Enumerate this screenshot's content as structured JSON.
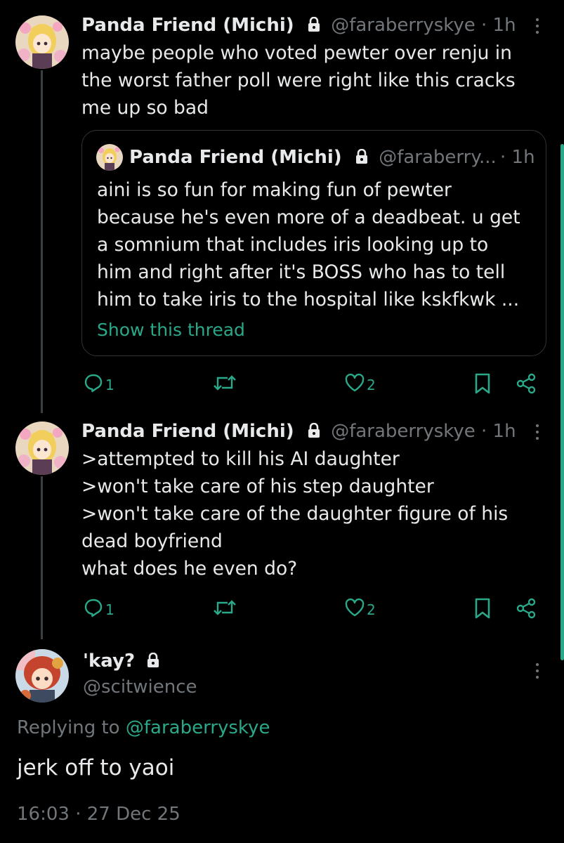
{
  "colors": {
    "background": "#000000",
    "accent": "#2aa889",
    "text": "#e7e9ea",
    "muted": "#71767b",
    "border": "#2f3336"
  },
  "post1": {
    "display_name": "Panda Friend (Michi)",
    "handle": "@faraberryskye",
    "time": "· 1h",
    "text_lines": [
      "maybe people who voted pewter over renju in",
      "the worst father poll were right like this cracks",
      "me up so bad"
    ],
    "quote": {
      "display_name": "Panda Friend (Michi)",
      "handle": "@faraberry...",
      "time": "· 1h",
      "text_lines": [
        "aini is so fun for making fun of pewter",
        "because he's even more of a deadbeat. u get",
        "a somnium that includes iris looking up to",
        "him and right after it's BOSS who has to tell",
        "him to take iris to the hospital like kskfkwk ..."
      ],
      "show_thread": "Show this thread"
    },
    "actions": {
      "replies": "1",
      "reposts": "",
      "likes": "2"
    }
  },
  "post2": {
    "display_name": "Panda Friend (Michi)",
    "handle": "@faraberryskye",
    "time": "· 1h",
    "text_lines": [
      ">attempted to kill his AI daughter",
      ">won't take care of his step daughter",
      ">won't take care of the daughter figure of his",
      "dead boyfriend",
      "what does he even do?"
    ],
    "actions": {
      "replies": "1",
      "reposts": "",
      "likes": "2"
    }
  },
  "main_post": {
    "display_name": "'kay?",
    "handle": "@scitwience",
    "replying_prefix": "Replying to",
    "replying_to": "@faraberryskye",
    "text": "jerk off to yaoi",
    "timestamp": "16:03 · 27 Dec 25"
  },
  "icons": {
    "lock": "lock-icon",
    "reply": "reply-icon",
    "repost": "repost-icon",
    "like": "heart-icon",
    "bookmark": "bookmark-icon",
    "share": "share-icon",
    "more": "more-icon"
  }
}
